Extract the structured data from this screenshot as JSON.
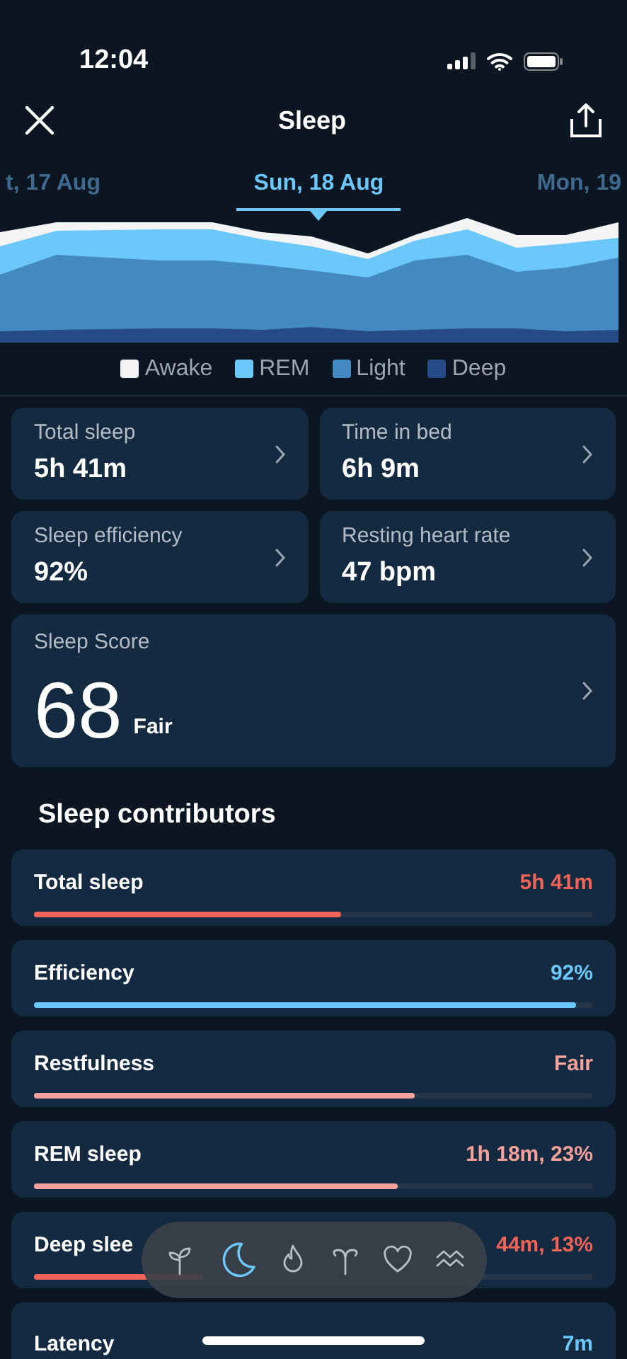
{
  "status_bar": {
    "time": "12:04"
  },
  "header": {
    "title": "Sleep"
  },
  "date_tabs": [
    {
      "label": "t, 17 Aug",
      "selected": false
    },
    {
      "label": "Sun, 18 Aug",
      "selected": true
    },
    {
      "label": "Mon, 19",
      "selected": false
    }
  ],
  "legend": [
    {
      "label": "Awake",
      "color": "#f2f4f6"
    },
    {
      "label": "REM",
      "color": "#6cc7fa"
    },
    {
      "label": "Light",
      "color": "#4389c2"
    },
    {
      "label": "Deep",
      "color": "#264a85"
    }
  ],
  "metrics": [
    {
      "label": "Total sleep",
      "value": "5h 41m"
    },
    {
      "label": "Time in bed",
      "value": "6h 9m"
    },
    {
      "label": "Sleep efficiency",
      "value": "92%"
    },
    {
      "label": "Resting heart rate",
      "value": "47 bpm"
    }
  ],
  "sleep_score": {
    "label": "Sleep Score",
    "value": "68",
    "rating": "Fair"
  },
  "contributors_title": "Sleep contributors",
  "contributors": [
    {
      "label": "Total sleep",
      "value": "5h 41m",
      "color": "#ef6456",
      "level": 0.55
    },
    {
      "label": "Efficiency",
      "value": "92%",
      "color": "#6cc7fa",
      "level": 0.97
    },
    {
      "label": "Restfulness",
      "value": "Fair",
      "color": "#f4a19b",
      "level": 0.68
    },
    {
      "label": "REM sleep",
      "value": "1h 18m, 23%",
      "color": "#f4a19b",
      "level": 0.65
    },
    {
      "label": "Deep slee",
      "value": "44m, 13%",
      "color": "#ef6456",
      "level": 0.3
    },
    {
      "label": "Latency",
      "value": "7m",
      "color": "#6cc7fa"
    }
  ],
  "bottom_nav": [
    {
      "kind": "sprout",
      "selected": false
    },
    {
      "kind": "moon",
      "selected": true
    },
    {
      "kind": "flame",
      "selected": false
    },
    {
      "kind": "branch",
      "selected": false
    },
    {
      "kind": "heart",
      "selected": false
    },
    {
      "kind": "waves",
      "selected": false
    }
  ]
}
